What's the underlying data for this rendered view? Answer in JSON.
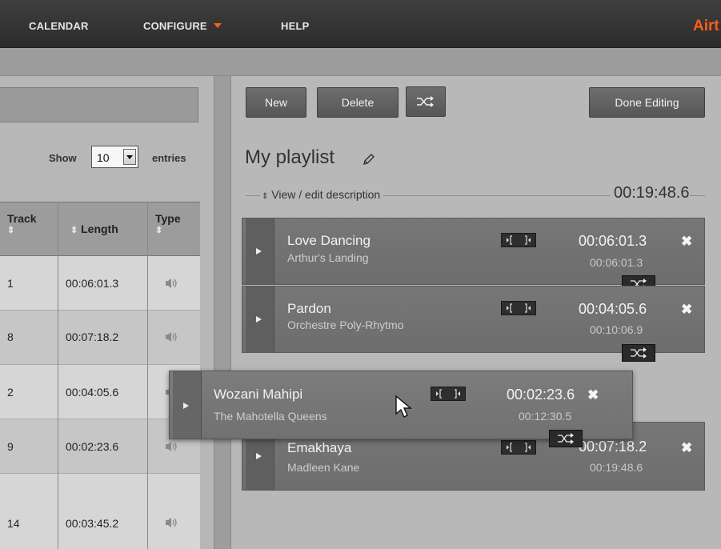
{
  "nav": {
    "items": [
      {
        "label": "CALENDAR"
      },
      {
        "label": "CONFIGURE"
      },
      {
        "label": "HELP"
      }
    ],
    "brand": "Airt",
    "accent_color": "#ff5d1a"
  },
  "library": {
    "show_label": "Show",
    "entries_label": "entries",
    "page_size": "10",
    "columns": [
      {
        "label": "Track",
        "sort_icon": "sort-icon"
      },
      {
        "label": "Length",
        "sort_icon": "sort-icon"
      },
      {
        "label": "Type",
        "sort_icon": "sort-icon"
      }
    ],
    "rows": [
      {
        "track": "1",
        "length": "00:06:01.3",
        "type_icon": "speaker-icon"
      },
      {
        "track": "8",
        "length": "00:07:18.2",
        "type_icon": "speaker-icon"
      },
      {
        "track": "2",
        "length": "00:04:05.6",
        "type_icon": "speaker-icon"
      },
      {
        "track": "9",
        "length": "00:02:23.6",
        "type_icon": "speaker-icon"
      },
      {
        "track": "14",
        "length": "00:03:45.2",
        "type_icon": "speaker-icon"
      }
    ]
  },
  "playlist": {
    "buttons": {
      "new": "New",
      "delete": "Delete",
      "shuffle_icon": "shuffle-icon",
      "done": "Done Editing"
    },
    "title": "My playlist",
    "description_link": "View / edit description",
    "total_length": "00:19:48.6",
    "items": [
      {
        "title": "Love Dancing",
        "artist": "Arthur's Landing",
        "length": "00:06:01.3",
        "cumulative": "00:06:01.3"
      },
      {
        "title": "Pardon",
        "artist": "Orchestre Poly-Rhytmo",
        "length": "00:04:05.6",
        "cumulative": "00:10:06.9"
      },
      {
        "title": "Emakhaya",
        "artist": "Madleen Kane",
        "length": "00:07:18.2",
        "cumulative": "00:19:48.6"
      }
    ],
    "dragging": {
      "title": "Wozani Mahipi",
      "artist": "The Mahotella Queens",
      "length": "00:02:23.6",
      "cumulative": "00:12:30.5"
    }
  }
}
